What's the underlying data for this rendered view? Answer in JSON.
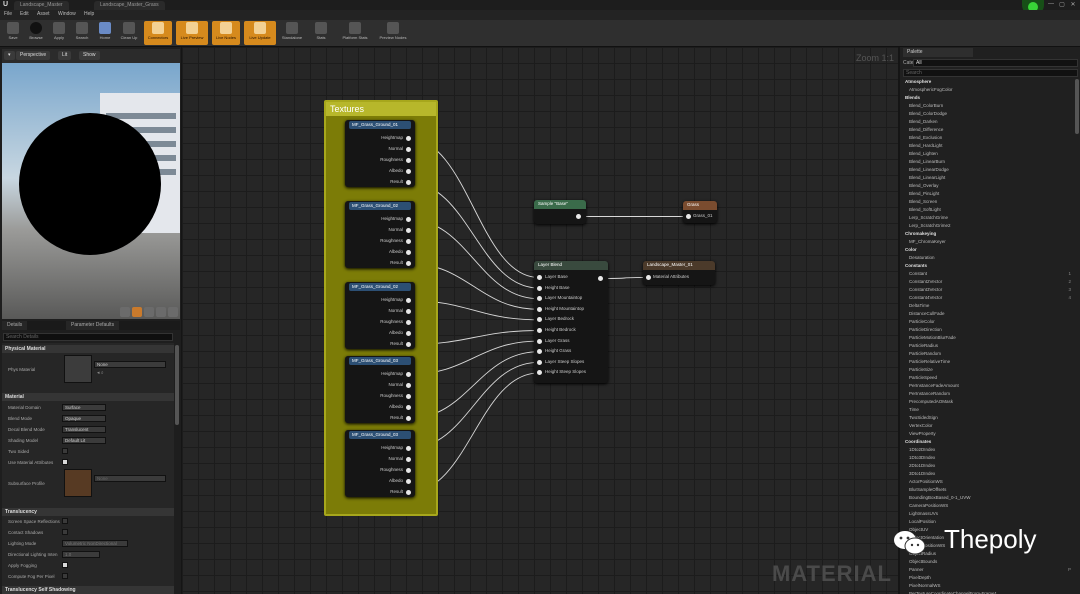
{
  "window": {
    "tabs": [
      "Landscape_Master",
      "Landscape_Master_Grass"
    ],
    "controls": [
      "—",
      "▢",
      "✕"
    ]
  },
  "menu": [
    "File",
    "Edit",
    "Asset",
    "Window",
    "Help"
  ],
  "toolbar": [
    "Save",
    "Browse",
    "Apply",
    "Search",
    "Home",
    "Clean Up",
    "Connectors",
    "Live Preview",
    "Live Nodes",
    "Live Update",
    "Stats",
    "Platform Stats",
    "Preview Nodes",
    "Standalone"
  ],
  "viewport": {
    "mode": "Perspective",
    "lit": "Lit",
    "show": "Show"
  },
  "details": {
    "tabs": [
      "Details",
      "Parameter Defaults"
    ],
    "search_placeholder": "Search Details",
    "physical_material": {
      "section": "Physical Material",
      "label": "Phys Material",
      "value": "None"
    },
    "material": {
      "section": "Material",
      "rows": [
        {
          "label": "Material Domain",
          "value": "Surface"
        },
        {
          "label": "Blend Mode",
          "value": "Opaque"
        },
        {
          "label": "Decal Blend Mode",
          "value": "Translucent"
        },
        {
          "label": "Shading Model",
          "value": "Default Lit"
        }
      ],
      "two_sided": "Two Sided",
      "use_attrs": "Use Material Attributes",
      "subsurface": "Subsurface Profile",
      "subsurface_value": "None"
    },
    "translucency": {
      "section": "Translucency",
      "rows": [
        "Screen Space Reflections",
        "Contact Shadows",
        "Lighting Mode",
        "Directional Lighting Inten",
        "Apply Fogging",
        "Compute Fog Per Pixel"
      ],
      "lighting_mode": "Volumetric NonDirectional",
      "dir_value": "1.0"
    },
    "self_shadow": "Translucency Self Shadowing"
  },
  "graph": {
    "zoom": "Zoom 1:1",
    "watermark": "MATERIAL",
    "comment_title": "Textures",
    "texture_nodes": [
      {
        "title": "MF_Grass_Ground_01"
      },
      {
        "title": "MF_Grass_Ground_02"
      },
      {
        "title": "MF_Grass_Ground_02"
      },
      {
        "title": "MF_Grass_Ground_03"
      },
      {
        "title": "MF_Grass_Ground_03"
      }
    ],
    "texture_pins": [
      "Heightmap",
      "Normal",
      "Roughness",
      "Albedo",
      "Result"
    ],
    "sample_node": {
      "title": "Sample \"Base\""
    },
    "grass_node": {
      "title": "Grass",
      "pin": "Grass_01"
    },
    "layer_blend": {
      "title": "Layer Blend",
      "pins": [
        "Layer Base",
        "Height Base",
        "Layer Mountaintop",
        "Height Mountaintop",
        "Layer Bedrock",
        "Height Bedrock",
        "Layer Grass",
        "Height Grass",
        "Layer Steep Slopes",
        "Height Steep Slopes"
      ]
    },
    "output_node": {
      "title": "Landscape_Master_01",
      "pin": "Material Attributes"
    }
  },
  "palette": {
    "tab": "Palette",
    "category_label": "Category",
    "category_value": "All",
    "search_placeholder": "Search",
    "items": [
      {
        "t": "Atmosphere",
        "c": true
      },
      {
        "t": "AtmosphericFogColor"
      },
      {
        "t": "Blends",
        "c": true
      },
      {
        "t": "Blend_ColorBurn"
      },
      {
        "t": "Blend_ColorDodge"
      },
      {
        "t": "Blend_Darken"
      },
      {
        "t": "Blend_Difference"
      },
      {
        "t": "Blend_Exclusion"
      },
      {
        "t": "Blend_HardLight"
      },
      {
        "t": "Blend_Lighten"
      },
      {
        "t": "Blend_LinearBurn"
      },
      {
        "t": "Blend_LinearDodge"
      },
      {
        "t": "Blend_LinearLight"
      },
      {
        "t": "Blend_Overlay"
      },
      {
        "t": "Blend_PinLight"
      },
      {
        "t": "Blend_Screen"
      },
      {
        "t": "Blend_SoftLight"
      },
      {
        "t": "Lerp_ScratchGrime"
      },
      {
        "t": "Lerp_ScratchGrime2"
      },
      {
        "t": "Chromakeying",
        "c": true
      },
      {
        "t": "MF_ChromaKeyer"
      },
      {
        "t": "Color",
        "c": true
      },
      {
        "t": "Desaturation"
      },
      {
        "t": "Constants",
        "c": true
      },
      {
        "t": "Constant",
        "s": "1"
      },
      {
        "t": "Constant2Vector",
        "s": "2"
      },
      {
        "t": "Constant3Vector",
        "s": "3"
      },
      {
        "t": "Constant4Vector",
        "s": "4"
      },
      {
        "t": "DeltaTime"
      },
      {
        "t": "DistanceCullFade"
      },
      {
        "t": "ParticleColor"
      },
      {
        "t": "ParticleDirection"
      },
      {
        "t": "ParticleMotionBlurFade"
      },
      {
        "t": "ParticleRadius"
      },
      {
        "t": "ParticleRandom"
      },
      {
        "t": "ParticleRelativeTime"
      },
      {
        "t": "ParticleSize"
      },
      {
        "t": "ParticleSpeed"
      },
      {
        "t": "PerInstanceFadeAmount"
      },
      {
        "t": "PerInstanceRandom"
      },
      {
        "t": "PrecomputedAOMask"
      },
      {
        "t": "Time"
      },
      {
        "t": "TwoSidedSign"
      },
      {
        "t": "VertexColor"
      },
      {
        "t": "ViewProperty"
      },
      {
        "t": "Coordinates",
        "c": true
      },
      {
        "t": "1Dto2DIndex"
      },
      {
        "t": "1Dto3DIndex"
      },
      {
        "t": "2Dto1DIndex"
      },
      {
        "t": "3Dto1DIndex"
      },
      {
        "t": "ActorPositionWS"
      },
      {
        "t": "BlurSampleOffsets"
      },
      {
        "t": "BoundingBoxBased_0-1_UVW"
      },
      {
        "t": "CameraPositionWS"
      },
      {
        "t": "LightmassUVs"
      },
      {
        "t": "LocalPosition"
      },
      {
        "t": "ObjectUV"
      },
      {
        "t": "ObjectOrientation"
      },
      {
        "t": "ObjectPositionWS"
      },
      {
        "t": "ObjectRadius"
      },
      {
        "t": "ObjectBounds"
      },
      {
        "t": "Panner",
        "s": "P"
      },
      {
        "t": "PixelDepth"
      },
      {
        "t": "PixelNormalWS"
      },
      {
        "t": "PerTextureCoordinateChannelFrom-Frame1"
      },
      {
        "t": "PerTextureCoordinateFrom-Tile4x4"
      }
    ]
  },
  "watermark": {
    "text": "Thepoly"
  }
}
